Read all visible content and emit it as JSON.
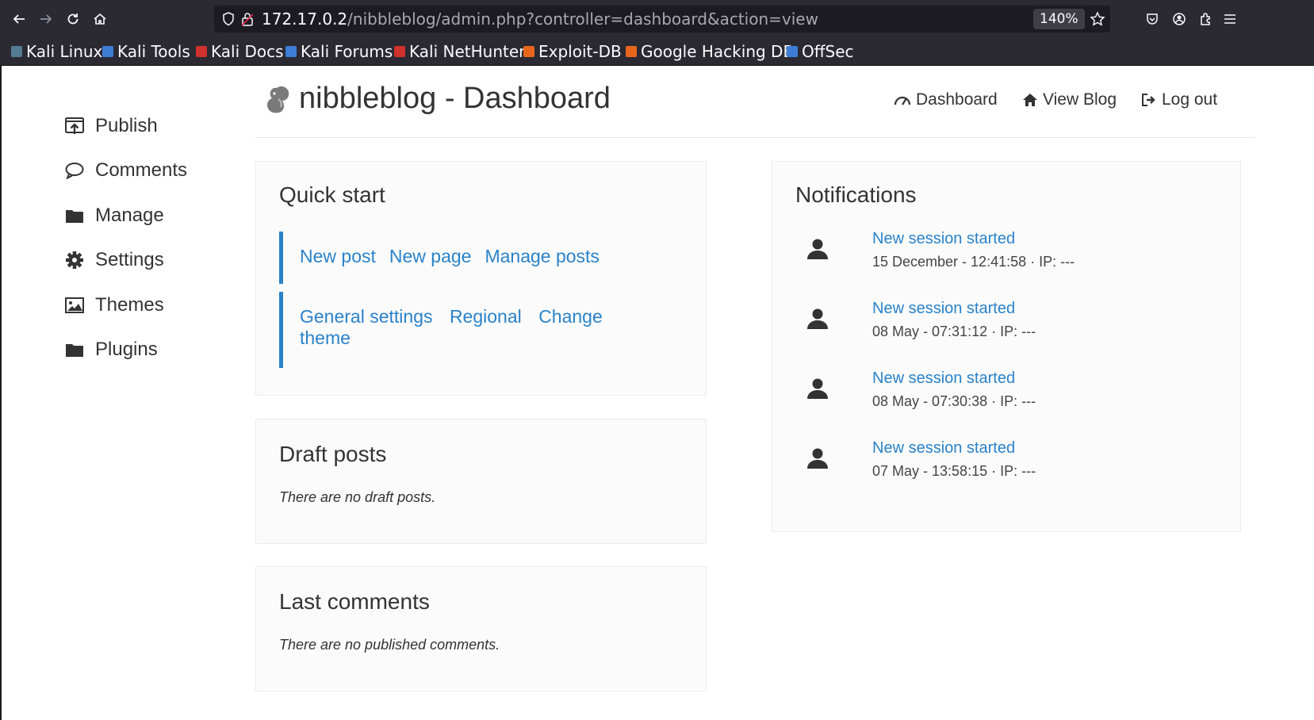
{
  "browser": {
    "url_host": "172.17.0.2",
    "url_path": "/nibbleblog/admin.php?controller=dashboard&action=view",
    "zoom": "140%",
    "bookmarks": [
      {
        "label": "Kali Linux",
        "color": "#557c94"
      },
      {
        "label": "Kali Tools",
        "color": "#3d7dd6"
      },
      {
        "label": "Kali Docs",
        "color": "#d0312d"
      },
      {
        "label": "Kali Forums",
        "color": "#3d7dd6"
      },
      {
        "label": "Kali NetHunter",
        "color": "#d0312d"
      },
      {
        "label": "Exploit-DB",
        "color": "#e8661b"
      },
      {
        "label": "Google Hacking DB",
        "color": "#e8661b"
      },
      {
        "label": "OffSec",
        "color": "#3d7dd6"
      }
    ]
  },
  "header": {
    "title": "nibbleblog - Dashboard",
    "nav": {
      "dashboard": "Dashboard",
      "view_blog": "View Blog",
      "logout": "Log out"
    }
  },
  "sidebar": {
    "items": [
      {
        "label": "Publish",
        "icon": "publish-icon"
      },
      {
        "label": "Comments",
        "icon": "comment-icon"
      },
      {
        "label": "Manage",
        "icon": "folder-icon"
      },
      {
        "label": "Settings",
        "icon": "gear-icon"
      },
      {
        "label": "Themes",
        "icon": "image-icon"
      },
      {
        "label": "Plugins",
        "icon": "folder-icon"
      }
    ]
  },
  "quick_start": {
    "title": "Quick start",
    "group1": {
      "new_post": "New post",
      "new_page": "New page",
      "manage_posts": "Manage posts"
    },
    "group2": {
      "general_settings": "General settings",
      "regional": "Regional",
      "change_theme": "Change theme"
    }
  },
  "draft_posts": {
    "title": "Draft posts",
    "empty": "There are no draft posts."
  },
  "last_comments": {
    "title": "Last comments",
    "empty": "There are no published comments."
  },
  "notifications": {
    "title": "Notifications",
    "items": [
      {
        "title": "New session started",
        "meta": "15 December - 12:41:58 · IP: ---"
      },
      {
        "title": "New session started",
        "meta": "08 May - 07:31:12 · IP: ---"
      },
      {
        "title": "New session started",
        "meta": "08 May - 07:30:38 · IP: ---"
      },
      {
        "title": "New session started",
        "meta": "07 May - 13:58:15 · IP: ---"
      }
    ]
  },
  "colors": {
    "link": "#2a82c9",
    "accent_bar": "#2a82c9",
    "chrome": "#2b2a33"
  }
}
